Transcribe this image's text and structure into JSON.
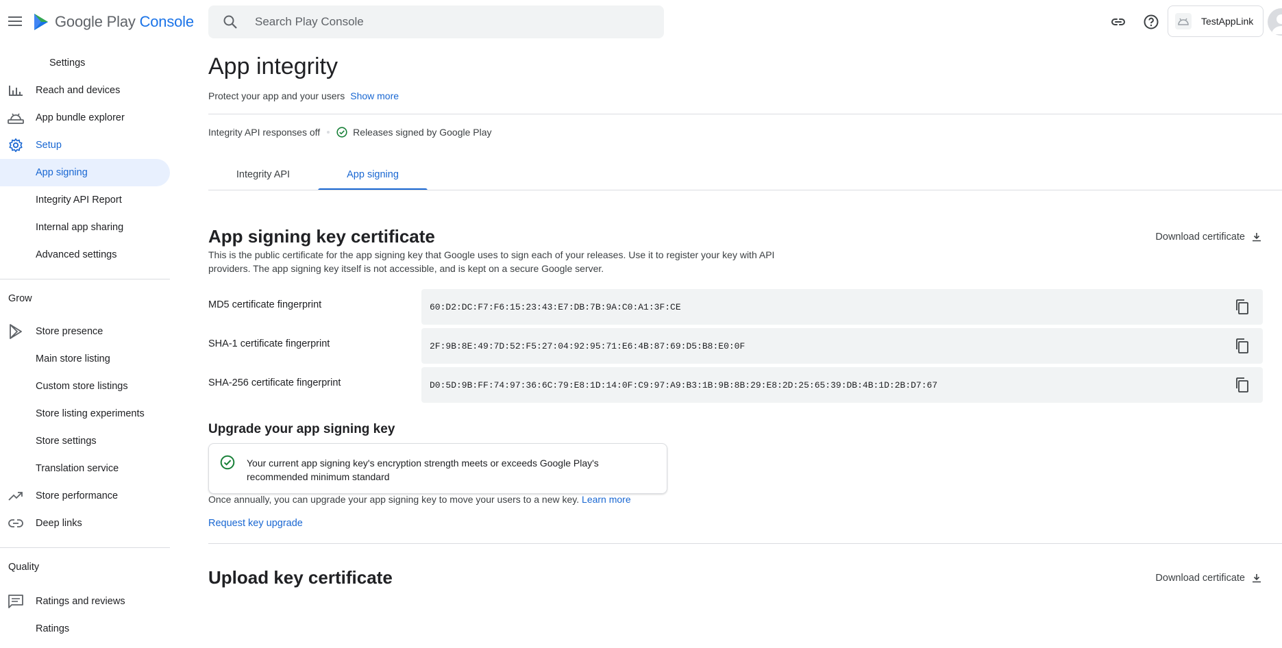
{
  "topbar": {
    "brand_primary": "Google Play",
    "brand_secondary": "Console",
    "search_placeholder": "Search Play Console",
    "account_name": "TestAppLink"
  },
  "sidebar": {
    "items": [
      {
        "label": "Settings",
        "icon": ""
      },
      {
        "label": "Reach and devices",
        "icon": "bar-chart-icon"
      },
      {
        "label": "App bundle explorer",
        "icon": "android-icon"
      },
      {
        "label": "Setup",
        "icon": "gear-icon"
      },
      {
        "label": "App signing",
        "icon": ""
      },
      {
        "label": "Integrity API Report",
        "icon": ""
      },
      {
        "label": "Internal app sharing",
        "icon": ""
      },
      {
        "label": "Advanced settings",
        "icon": ""
      },
      {
        "label": "Store presence",
        "icon": "play-icon"
      },
      {
        "label": "Main store listing",
        "icon": ""
      },
      {
        "label": "Custom store listings",
        "icon": ""
      },
      {
        "label": "Store listing experiments",
        "icon": ""
      },
      {
        "label": "Store settings",
        "icon": ""
      },
      {
        "label": "Translation service",
        "icon": ""
      },
      {
        "label": "Store performance",
        "icon": "trending-up-icon"
      },
      {
        "label": "Deep links",
        "icon": "link-icon"
      },
      {
        "label": "Ratings and reviews",
        "icon": "review-icon"
      },
      {
        "label": "Ratings",
        "icon": ""
      }
    ],
    "headings": {
      "grow": "Grow",
      "quality": "Quality"
    }
  },
  "main": {
    "title": "App integrity",
    "subtitle": "Protect your app and your users",
    "show_more": "Show more",
    "status": {
      "integrity": "Integrity API responses off",
      "releases": "Releases signed by Google Play"
    },
    "tabs": [
      {
        "label": "Integrity API"
      },
      {
        "label": "App signing"
      }
    ],
    "app_signing": {
      "title": "App signing key certificate",
      "description": "This is the public certificate for the app signing key that Google uses to sign each of your releases. Use it to register your key with API providers. The app signing key itself is not accessible, and is kept on a secure Google server.",
      "download_label": "Download certificate",
      "fingerprints": [
        {
          "label": "MD5 certificate fingerprint",
          "value": "60:D2:DC:F7:F6:15:23:43:E7:DB:7B:9A:C0:A1:3F:CE"
        },
        {
          "label": "SHA-1 certificate fingerprint",
          "value": "2F:9B:8E:49:7D:52:F5:27:04:92:95:71:E6:4B:87:69:D5:B8:E0:0F"
        },
        {
          "label": "SHA-256 certificate fingerprint",
          "value": "D0:5D:9B:FF:74:97:36:6C:79:E8:1D:14:0F:C9:97:A9:B3:1B:9B:8B:29:E8:2D:25:65:39:DB:4B:1D:2B:D7:67"
        }
      ]
    },
    "upgrade": {
      "title": "Upgrade your app signing key",
      "notice": "Your current app signing key's encryption strength meets or exceeds Google Play's recommended minimum standard",
      "info": "Once annually, you can upgrade your app signing key to move your users to a new key.",
      "learn_more": "Learn more",
      "request_label": "Request key upgrade"
    },
    "upload": {
      "title": "Upload key certificate",
      "download_label": "Download certificate"
    }
  },
  "colors": {
    "accent": "#1967d2",
    "success": "#188038",
    "active_bg": "#e8f0fe"
  }
}
